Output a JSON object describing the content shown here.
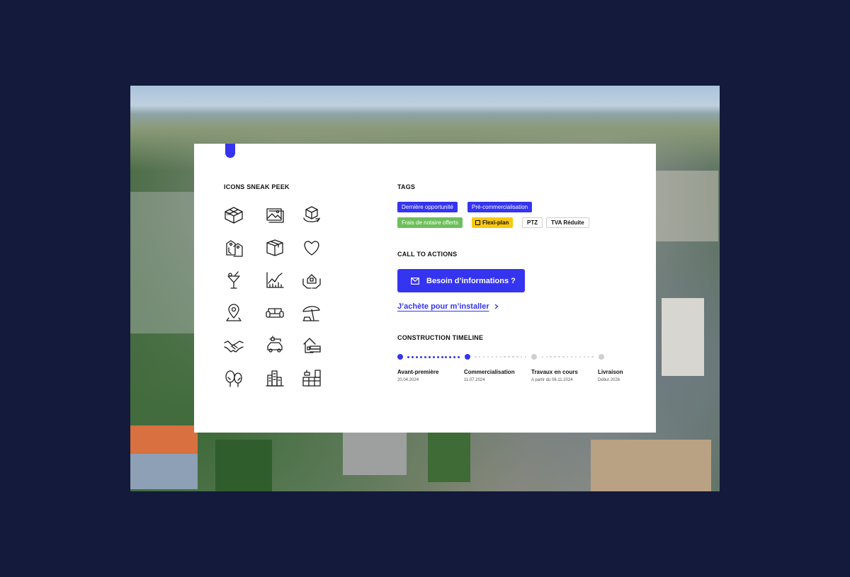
{
  "icons": {
    "title": "ICONS SNEAK PEEK",
    "items": [
      "3d-floorplan-icon",
      "picture-icon",
      "rotating-cube-icon",
      "key-tag-icon",
      "package-box-icon",
      "heart-icon",
      "cocktail-icon",
      "chart-growth-icon",
      "house-in-hands-icon",
      "location-pin-icon",
      "sofa-icon",
      "beach-umbrella-icon",
      "handshake-icon",
      "electric-car-icon",
      "house-stack-icon",
      "trees-icon",
      "city-buildings-icon",
      "kitchen-icon"
    ]
  },
  "tags": {
    "title": "TAGS",
    "items": [
      {
        "label": "Dernière opportunité",
        "style": "blue"
      },
      {
        "label": "Pré-commercialisation",
        "style": "blue"
      },
      {
        "label": "Frais de notaire offerts",
        "style": "green"
      },
      {
        "label": "Flexi-plan",
        "style": "yellow",
        "icon": "floorplan-icon"
      },
      {
        "label": "PTZ",
        "style": "outline"
      },
      {
        "label": "TVA Réduite",
        "style": "outline"
      }
    ]
  },
  "cta": {
    "title": "CALL TO ACTIONS",
    "primary_label": "Besoin d’informations ?",
    "primary_icon": "mail-icon",
    "secondary_label": "J’achète pour m’installer",
    "secondary_icon": "chevron-right-icon"
  },
  "timeline": {
    "title": "CONSTRUCTION TIMELINE",
    "steps": [
      {
        "name": "Avant-première",
        "date": "20.04.2024",
        "done": true
      },
      {
        "name": "Commercialisation",
        "date": "11.07.2024",
        "done": true
      },
      {
        "name": "Travaux en cours",
        "date": "A partir du 06.11.2024",
        "done": false
      },
      {
        "name": "Livraison",
        "date": "Début 2026",
        "done": false
      }
    ]
  },
  "colors": {
    "background": "#141a3c",
    "accent": "#3534f0",
    "green": "#6cbf5a",
    "yellow": "#f9c80e",
    "inactive": "#cfcfcf"
  }
}
